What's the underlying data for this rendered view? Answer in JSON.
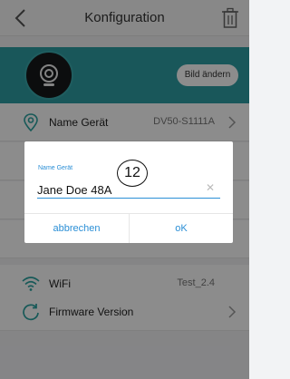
{
  "header": {
    "title": "Konfiguration"
  },
  "banner": {
    "change_label": "Bild ändern"
  },
  "rows": {
    "device_name": {
      "label": "Name Gerät",
      "value": "DV50-S1111A"
    },
    "wifi": {
      "label": "WiFi",
      "value": "Test_2.4"
    },
    "firmware": {
      "label": "Firmware Version"
    }
  },
  "dialog": {
    "field_label": "Name Gerät",
    "field_value": "Jane Doe 48A",
    "annotation": "12",
    "cancel_label": "abbrechen",
    "ok_label": "oK"
  },
  "colors": {
    "accent": "#2b8fd6",
    "banner": "#2f9fa4",
    "icon": "#2aa3a0"
  },
  "icons": [
    "back-arrow-icon",
    "trash-icon",
    "camera-icon",
    "location-pin-icon",
    "wifi-icon",
    "refresh-icon",
    "chevron-right-icon",
    "clear-icon"
  ]
}
